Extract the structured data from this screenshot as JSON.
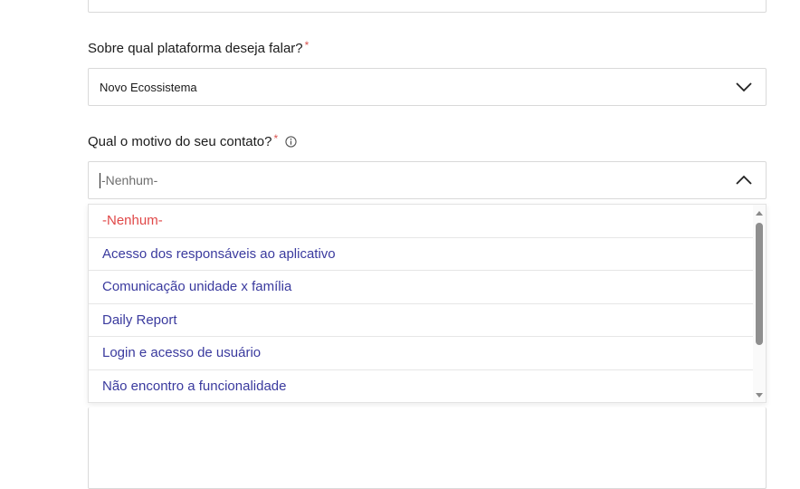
{
  "platform_field": {
    "label": "Sobre qual plataforma deseja falar?",
    "required_mark": "*",
    "value": "Novo Ecossistema"
  },
  "reason_field": {
    "label": "Qual o motivo do seu contato?",
    "required_mark": "*",
    "placeholder": "-Nenhum-"
  },
  "reason_options": [
    "-Nenhum-",
    "Acesso dos responsáveis ao aplicativo",
    "Comunicação unidade x família",
    "Daily Report",
    "Login e acesso de usuário",
    "Não encontro a funcionalidade"
  ],
  "icons": {
    "info": "info-icon",
    "platform_chevron": "chevron-down-icon",
    "reason_chevron": "chevron-up-icon"
  },
  "colors": {
    "required": "#d9534f",
    "option_text": "#3a3a9e",
    "none_option_text": "#e04848"
  }
}
